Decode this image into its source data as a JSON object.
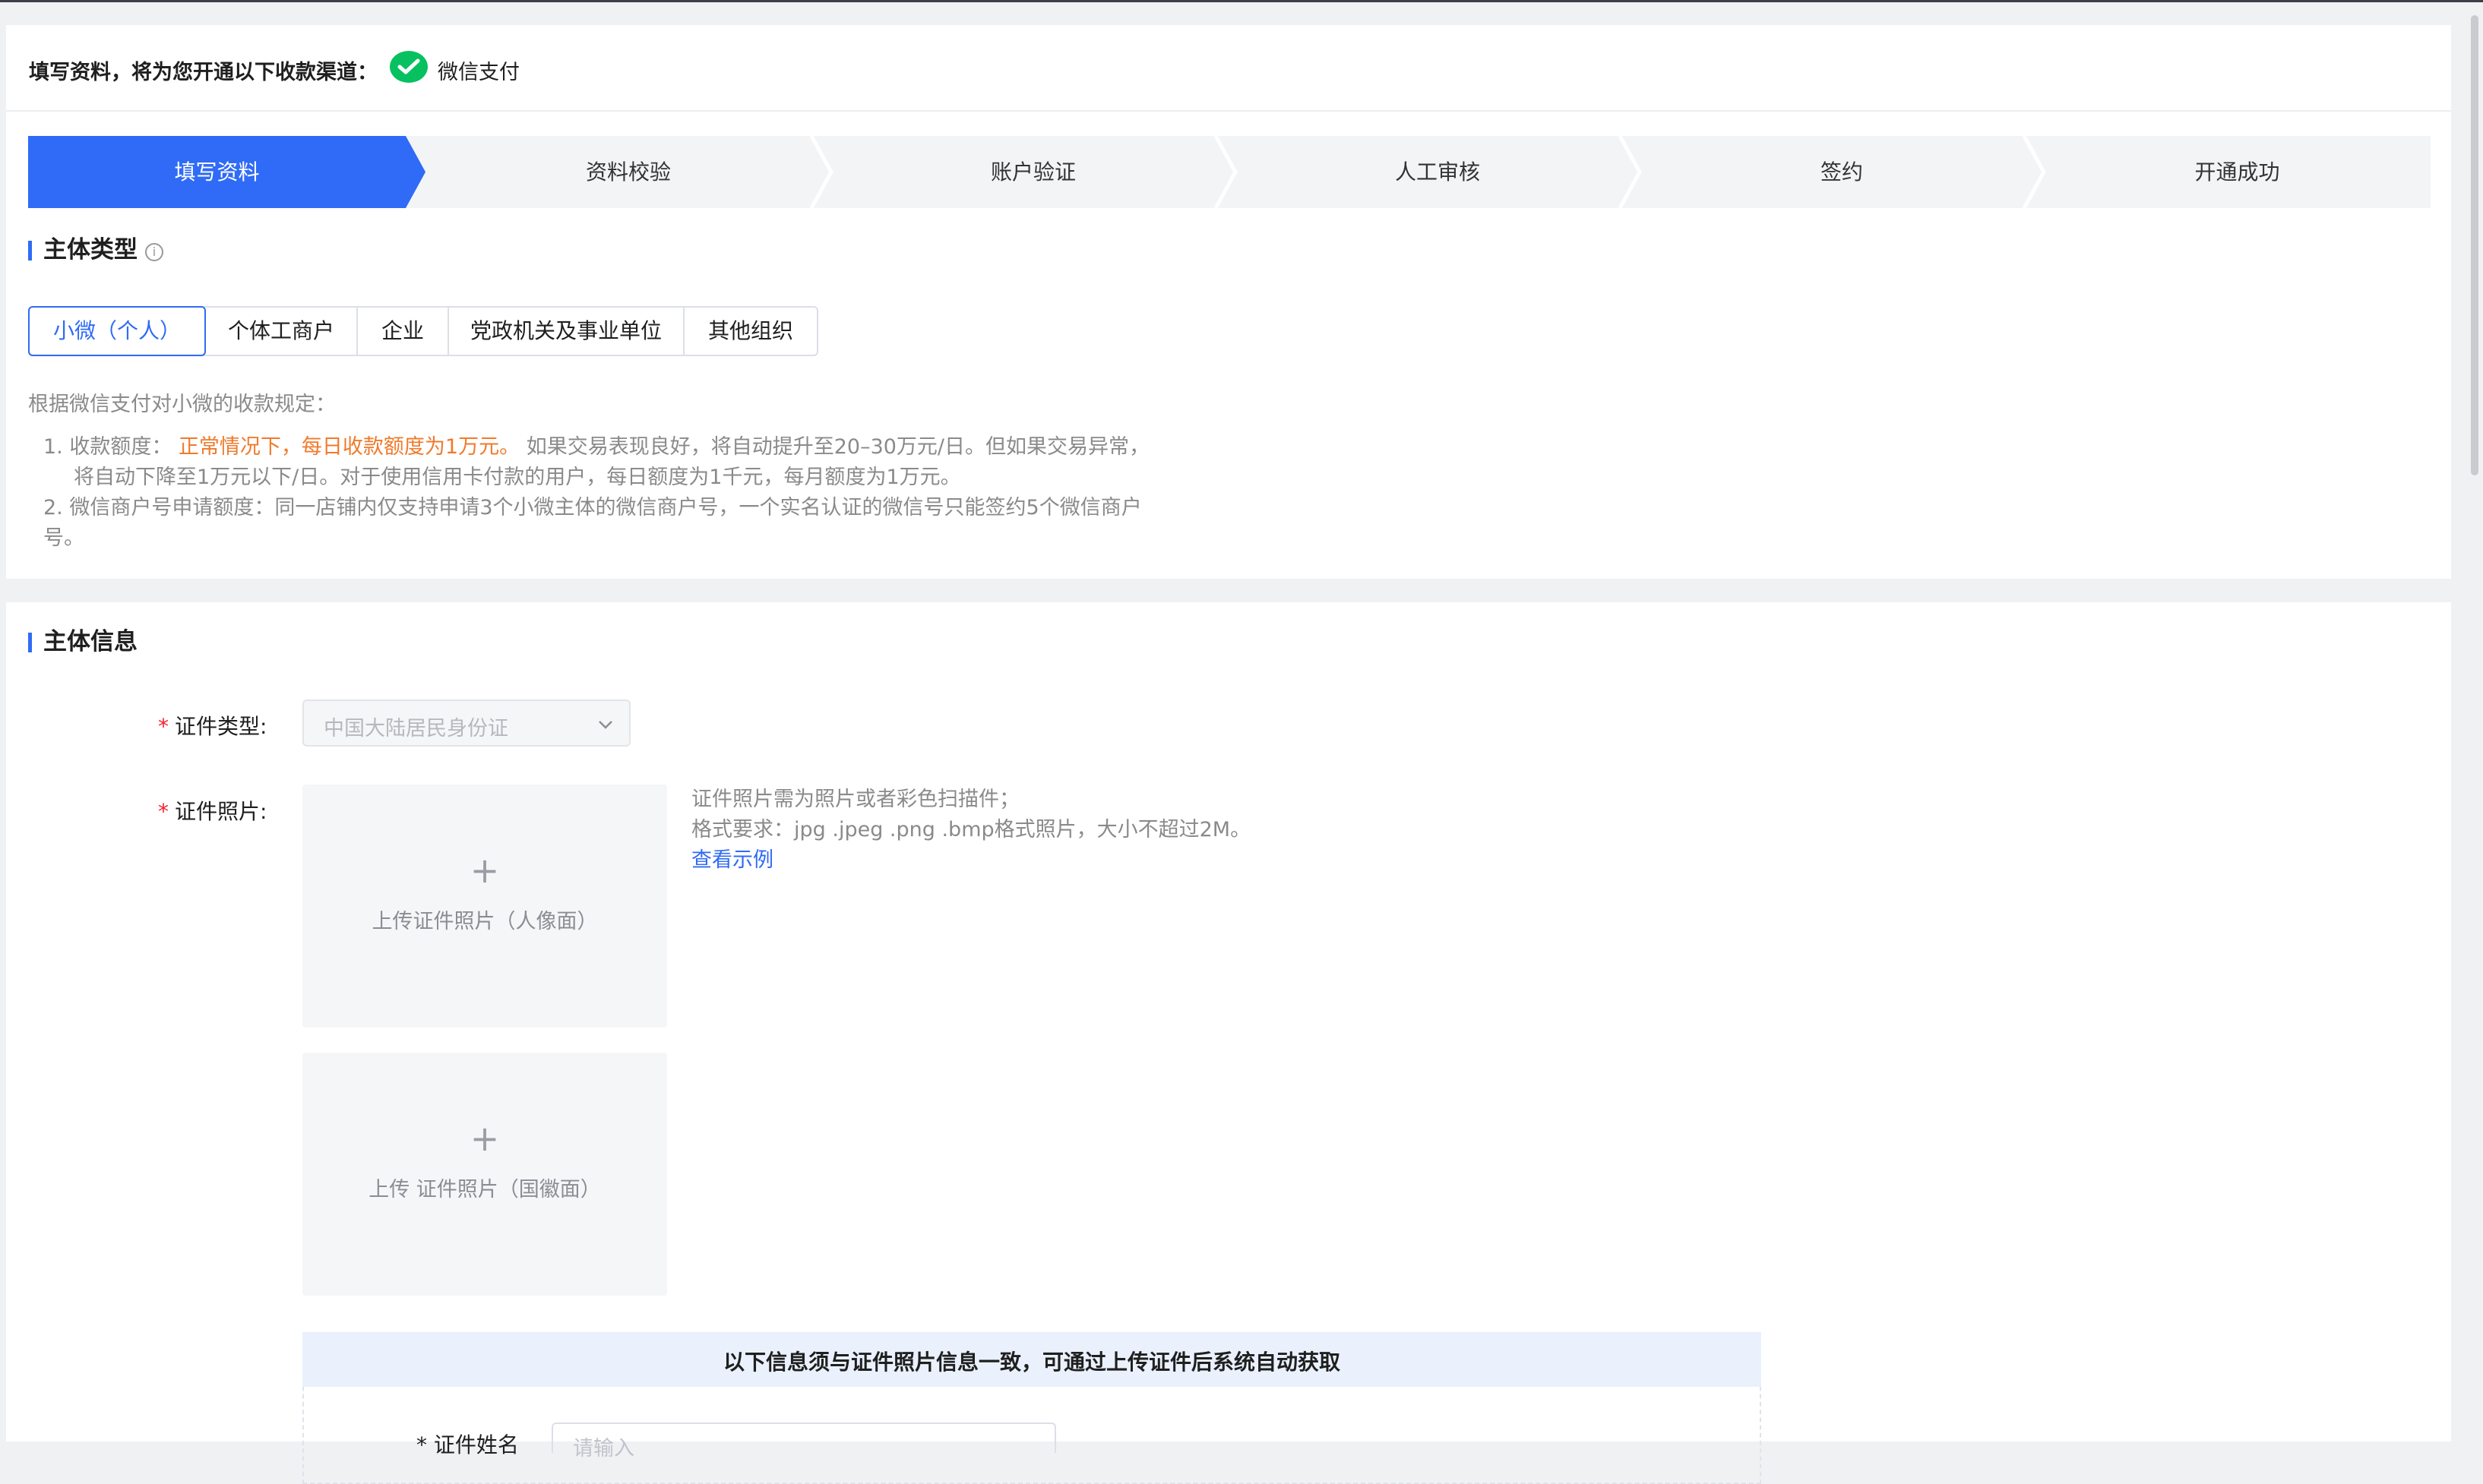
{
  "header": {
    "text": "填写资料，将为您开通以下收款渠道：",
    "channel": "微信支付",
    "channel_icon": "wechat-pay-icon",
    "channel_color": "#07c160"
  },
  "steps": [
    {
      "label": "填写资料",
      "active": true
    },
    {
      "label": "资料校验",
      "active": false
    },
    {
      "label": "账户验证",
      "active": false
    },
    {
      "label": "人工审核",
      "active": false
    },
    {
      "label": "签约",
      "active": false
    },
    {
      "label": "开通成功",
      "active": false
    }
  ],
  "colors": {
    "accent": "#2f6bf6",
    "highlight": "#f07a2b",
    "required": "#f5222d"
  },
  "subject_type": {
    "title": "主体类型",
    "info_icon": "info-icon",
    "tabs": [
      "小微（个人）",
      "个体工商户",
      "企业",
      "党政机关及事业单位",
      "其他组织"
    ],
    "selected": "小微（个人）"
  },
  "rules": {
    "intro": "根据微信支付对小微的收款规定：",
    "item1_prefix": "1. 收款额度：",
    "item1_highlight": "正常情况下，每日收款额度为1万元。",
    "item1_rest": "如果交易表现良好，将自动提升至20–30万元/日。但如果交易异常，",
    "item1_line2": "将自动下降至1万元以下/日。对于使用信用卡付款的用户，每日额度为1千元，每月额度为1万元。",
    "item2_line1": "2. 微信商户号申请额度：同一店铺内仅支持申请3个小微主体的微信商户号，一个实名认证的微信号只能签约5个微信商户",
    "item2_line2": "号。"
  },
  "subject_info": {
    "title": "主体信息",
    "id_type_label": "证件类型:",
    "id_type_value": "中国大陆居民身份证",
    "id_photo_label": "证件照片:",
    "upload_front": "上传证件照片（人像面）",
    "upload_back": "上传 证件照片（国徽面）",
    "hint_line1": "证件照片需为照片或者彩色扫描件；",
    "hint_line2": "格式要求：jpg .jpeg .png .bmp格式照片，大小不超过2M。",
    "hint_link": "查看示例",
    "notice": "以下信息须与证件照片信息一致，可通过上传证件后系统自动获取",
    "name_label": "* 证件姓名",
    "name_placeholder": "请输入"
  }
}
